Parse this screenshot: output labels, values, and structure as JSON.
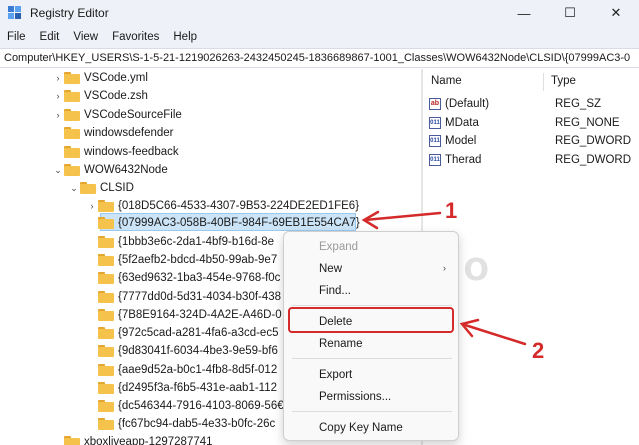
{
  "window": {
    "title": "Registry Editor",
    "controls": {
      "minimize": "—",
      "maximize": "☐",
      "close": "✕"
    }
  },
  "menu": [
    "File",
    "Edit",
    "View",
    "Favorites",
    "Help"
  ],
  "address": "Computer\\HKEY_USERS\\S-1-5-21-1219026263-2432450245-1836689867-1001_Classes\\WOW6432Node\\CLSID\\{07999AC3-0",
  "tree": [
    {
      "label": "VSCode.yml",
      "expanded": false
    },
    {
      "label": "VSCode.zsh",
      "expanded": false
    },
    {
      "label": "VSCodeSourceFile",
      "expanded": false
    },
    {
      "label": "windowsdefender",
      "expanded": false
    },
    {
      "label": "windows-feedback",
      "expanded": false
    },
    {
      "label": "WOW6432Node",
      "expanded": true
    },
    {
      "label": "CLSID",
      "expanded": true
    },
    {
      "label": "{018D5C66-4533-4307-9B53-224DE2ED1FE6}",
      "expanded": false
    },
    {
      "label": "{07999AC3-058B-40BF-984F-69EB1E554CA7}",
      "expanded": false,
      "selected": true
    },
    {
      "label": "{1bbb3e6c-2da1-4bf9-b16d-8e",
      "expanded": false
    },
    {
      "label": "{5f2aefb2-bdcd-4b50-99ab-9e7",
      "expanded": false
    },
    {
      "label": "{63ed9632-1ba3-454e-9768-f0c",
      "expanded": false
    },
    {
      "label": "{7777dd0d-5d31-4034-b30f-438",
      "expanded": false
    },
    {
      "label": "{7B8E9164-324D-4A2E-A46D-0",
      "expanded": false
    },
    {
      "label": "{972c5cad-a281-4fa6-a3cd-ec5",
      "expanded": false
    },
    {
      "label": "{9d83041f-6034-4be3-9e59-bf6",
      "expanded": false
    },
    {
      "label": "{aae9d52a-b0c1-4fb8-8d5f-012",
      "expanded": false
    },
    {
      "label": "{d2495f3a-f6b5-431e-aab1-112",
      "expanded": false
    },
    {
      "label": "{dc546344-7916-4103-8069-56€",
      "expanded": false
    },
    {
      "label": "{fc67bc94-dab5-4e33-b0fc-26c",
      "expanded": false
    },
    {
      "label": "xboxliveapp-1297287741",
      "expanded": false
    }
  ],
  "values_pane": {
    "col_name": "Name",
    "col_type": "Type",
    "rows": [
      {
        "name": "(Default)",
        "type": "REG_SZ",
        "icon": "string-value-icon",
        "glyph": "ab"
      },
      {
        "name": "MData",
        "type": "REG_NONE",
        "icon": "binary-value-icon",
        "glyph": "011"
      },
      {
        "name": "Model",
        "type": "REG_DWORD",
        "icon": "binary-value-icon",
        "glyph": "011"
      },
      {
        "name": "Therad",
        "type": "REG_DWORD",
        "icon": "binary-value-icon",
        "glyph": "011"
      }
    ]
  },
  "context_menu": {
    "expand": "Expand",
    "new": "New",
    "new_arrow": "›",
    "find": "Find...",
    "delete": "Delete",
    "rename": "Rename",
    "export": "Export",
    "permissions": "Permissions...",
    "copy_key_name": "Copy Key Name"
  },
  "watermark": "UGITEKNO",
  "callouts": {
    "one": "1",
    "two": "2"
  },
  "colors": {
    "accent_red": "#d42a2a",
    "selection": "#cce4f7",
    "folder": "#f5c24c"
  }
}
